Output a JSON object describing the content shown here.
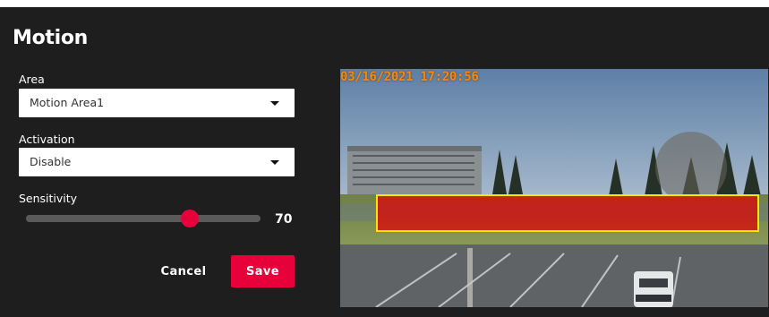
{
  "dialog": {
    "title": "Motion",
    "area": {
      "label": "Area",
      "value": "Motion Area1"
    },
    "activation": {
      "label": "Activation",
      "value": "Disable"
    },
    "sensitivity": {
      "label": "Sensitivity",
      "value": 70,
      "fraction": 0.7
    },
    "buttons": {
      "cancel": "Cancel",
      "save": "Save"
    }
  },
  "preview": {
    "timestamp": "03/16/2021 17:20:56",
    "icons": {
      "dropdown": "chevron-down-icon"
    }
  },
  "colors": {
    "panel_bg": "#1e1e1e",
    "accent": "#e8003a",
    "timestamp": "#ef8a1a",
    "motion_area_border": "#ffe600",
    "motion_area_fill": "#e10000"
  }
}
